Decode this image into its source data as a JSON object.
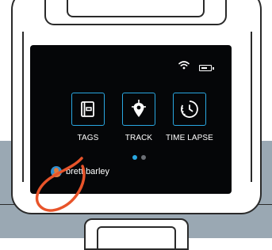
{
  "screen": {
    "status": {
      "wifi_icon": "wifi-icon",
      "battery_icon": "battery-icon"
    },
    "apps": [
      {
        "label": "TAGS",
        "icon": "tag-book-icon"
      },
      {
        "label": "TRACK",
        "icon": "location-pin-icon"
      },
      {
        "label": "TIME LAPSE",
        "icon": "timer-icon"
      }
    ],
    "pagination": {
      "pages": 2,
      "active": 1
    },
    "user": {
      "name": "brett barley",
      "avatar": "avatar-icon"
    }
  },
  "colors": {
    "accent": "#29a7e1",
    "screen_bg": "#050608",
    "annotation": "#e8542a",
    "backdrop": "#9aa8b3"
  }
}
